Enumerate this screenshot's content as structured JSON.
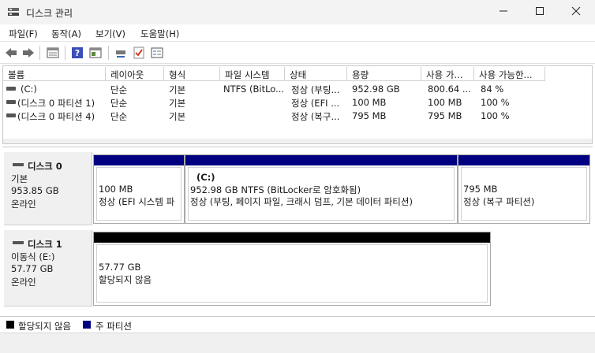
{
  "window": {
    "title": "디스크 관리"
  },
  "menu": [
    "파일(F)",
    "동작(A)",
    "보기(V)",
    "도움말(H)"
  ],
  "toolbar_icons": [
    "back-arrow-icon",
    "forward-arrow-icon",
    "disk-list-icon",
    "help-icon",
    "properties-icon",
    "connect-icon",
    "check-icon",
    "settings-list-icon"
  ],
  "volume_table": {
    "columns": [
      "볼륨",
      "레이아웃",
      "형식",
      "파일 시스템",
      "상태",
      "용량",
      "사용 가...",
      "사용 가능한..."
    ],
    "rows": [
      [
        "(C:)",
        "단순",
        "기본",
        "NTFS (BitLo...",
        "정상 (부팅...",
        "952.98 GB",
        "800.64 ...",
        "84 %"
      ],
      [
        "(디스크 0 파티션 1)",
        "단순",
        "기본",
        "",
        "정상 (EFI ...",
        "100 MB",
        "100 MB",
        "100 %"
      ],
      [
        "(디스크 0 파티션 4)",
        "단순",
        "기본",
        "",
        "정상 (복구...",
        "795 MB",
        "795 MB",
        "100 %"
      ]
    ]
  },
  "disks": [
    {
      "name": "디스크 0",
      "type": "기본",
      "size": "953.85 GB",
      "status": "온라인",
      "partitions": [
        {
          "title": "",
          "size": "100 MB",
          "status": "정상 (EFI 시스템 파",
          "color": "#000080"
        },
        {
          "title": "(C:)",
          "size": "952.98 GB NTFS (BitLocker로 암호화됨)",
          "status": "정상 (부팅, 페이지 파일, 크래시 덤프, 기본 데이터 파티션)",
          "color": "#000080"
        },
        {
          "title": "",
          "size": "795 MB",
          "status": "정상 (복구 파티션)",
          "color": "#000080"
        }
      ]
    },
    {
      "name": "디스크 1",
      "type": "이동식 (E:)",
      "size": "57.77 GB",
      "status": "온라인",
      "partitions": [
        {
          "title": "",
          "size": "57.77 GB",
          "status": "할당되지 않음",
          "color": "#000000"
        }
      ]
    }
  ],
  "legend": [
    {
      "label": "할당되지 않음",
      "color": "#000000"
    },
    {
      "label": "주 파티션",
      "color": "#000080"
    }
  ]
}
